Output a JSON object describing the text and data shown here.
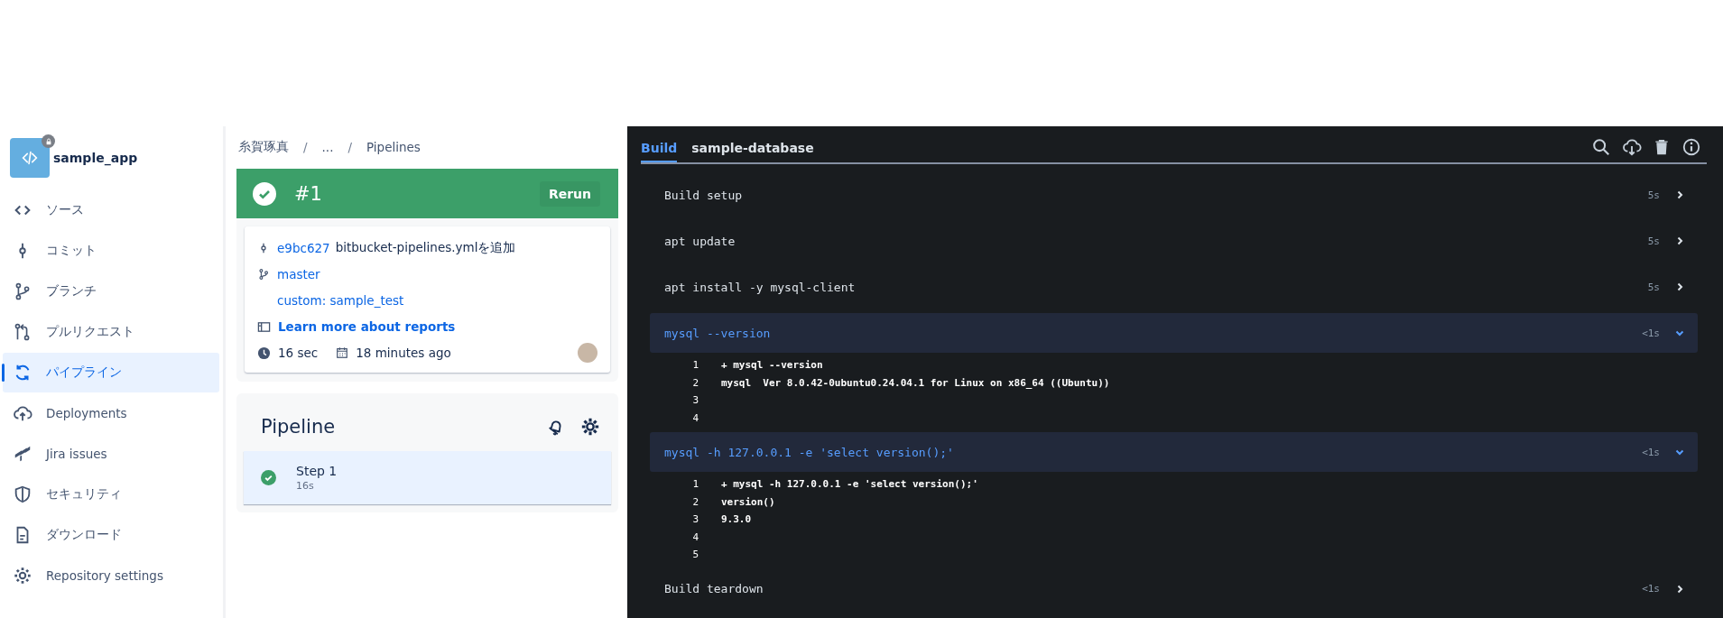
{
  "repo": {
    "name": "sample_app"
  },
  "sidebar": {
    "items": [
      {
        "label": "ソース",
        "selected": false
      },
      {
        "label": "コミット",
        "selected": false
      },
      {
        "label": "ブランチ",
        "selected": false
      },
      {
        "label": "プルリクエスト",
        "selected": false
      },
      {
        "label": "パイプライン",
        "selected": true
      },
      {
        "label": "Deployments",
        "selected": false
      },
      {
        "label": "Jira issues",
        "selected": false
      },
      {
        "label": "セキュリティ",
        "selected": false
      },
      {
        "label": "ダウンロード",
        "selected": false
      },
      {
        "label": "Repository settings",
        "selected": false
      }
    ]
  },
  "breadcrumb": [
    {
      "kind": "link",
      "text": "糸賀琢真"
    },
    {
      "kind": "separator",
      "text": "/"
    },
    {
      "kind": "link",
      "text": "..."
    },
    {
      "kind": "separator",
      "text": "/"
    },
    {
      "kind": "link",
      "text": "Pipelines"
    }
  ],
  "run": {
    "number": "#1",
    "passed": true,
    "action": "Rerun",
    "commit_hash": "e9bc627",
    "commit_message": "bitbucket-pipelines.ymlを追加",
    "branch": "master",
    "trigger": "custom: sample_test",
    "reports_link": "Learn more about reports",
    "duration": "16 sec",
    "started": "18 minutes ago"
  },
  "pipeline": {
    "title": "Pipeline",
    "steps": [
      {
        "name": "Step 1",
        "duration": "16s",
        "passed": true,
        "selected": true
      }
    ]
  },
  "log": {
    "tabs": [
      {
        "label": "Build",
        "selected": true
      },
      {
        "label": "sample-database",
        "selected": false
      }
    ],
    "sections": [
      {
        "title": "Build setup",
        "duration": "5s",
        "expanded": false
      },
      {
        "title": "apt update",
        "duration": "5s",
        "expanded": false
      },
      {
        "title": "apt install -y mysql-client",
        "duration": "5s",
        "expanded": false
      },
      {
        "title": "mysql --version",
        "duration": "<1s",
        "expanded": true,
        "lines": [
          {
            "number": "1",
            "text": "+ mysql --version"
          },
          {
            "number": "2",
            "text": "mysql  Ver 8.0.42-0ubuntu0.24.04.1 for Linux on x86_64 ((Ubuntu))"
          },
          {
            "number": "3"
          },
          {
            "number": "4"
          }
        ]
      },
      {
        "title": "mysql -h 127.0.0.1 -e 'select version();'",
        "duration": "<1s",
        "expanded": true,
        "lines": [
          {
            "number": "1",
            "text": "+ mysql -h 127.0.0.1 -e 'select version();'"
          },
          {
            "number": "2",
            "text": "version()"
          },
          {
            "number": "3",
            "text": "9.3.0"
          },
          {
            "number": "4"
          },
          {
            "number": "5"
          }
        ]
      },
      {
        "title": "Build teardown",
        "duration": "<1s",
        "expanded": false
      }
    ]
  }
}
